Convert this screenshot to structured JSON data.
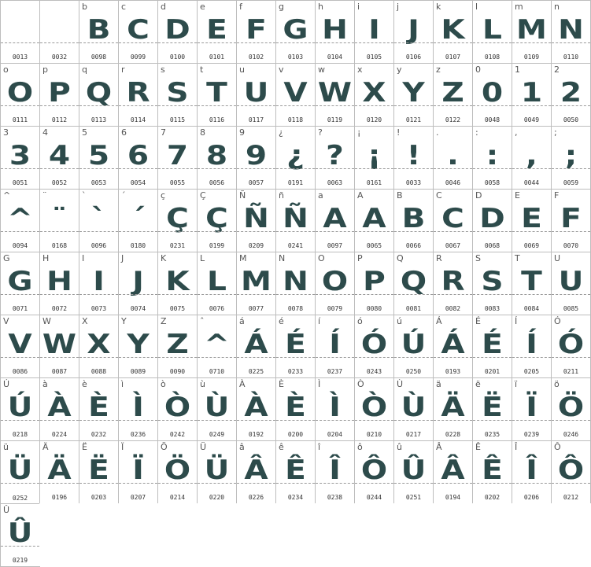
{
  "colors": {
    "glyph": "#2d4b4b",
    "grid": "#bdbdbd",
    "baseline": "#9a9a9a"
  },
  "glyphs": [
    {
      "label": "",
      "glyph": "",
      "code": "0013"
    },
    {
      "label": "",
      "glyph": "",
      "code": "0032"
    },
    {
      "label": "b",
      "glyph": "B",
      "code": "0098"
    },
    {
      "label": "c",
      "glyph": "C",
      "code": "0099"
    },
    {
      "label": "d",
      "glyph": "D",
      "code": "0100"
    },
    {
      "label": "e",
      "glyph": "E",
      "code": "0101"
    },
    {
      "label": "f",
      "glyph": "F",
      "code": "0102"
    },
    {
      "label": "g",
      "glyph": "G",
      "code": "0103"
    },
    {
      "label": "h",
      "glyph": "H",
      "code": "0104"
    },
    {
      "label": "i",
      "glyph": "I",
      "code": "0105"
    },
    {
      "label": "j",
      "glyph": "J",
      "code": "0106"
    },
    {
      "label": "k",
      "glyph": "K",
      "code": "0107"
    },
    {
      "label": "l",
      "glyph": "L",
      "code": "0108"
    },
    {
      "label": "m",
      "glyph": "M",
      "code": "0109"
    },
    {
      "label": "n",
      "glyph": "N",
      "code": "0110"
    },
    {
      "label": "o",
      "glyph": "O",
      "code": "0111"
    },
    {
      "label": "p",
      "glyph": "P",
      "code": "0112"
    },
    {
      "label": "q",
      "glyph": "Q",
      "code": "0113"
    },
    {
      "label": "r",
      "glyph": "R",
      "code": "0114"
    },
    {
      "label": "s",
      "glyph": "S",
      "code": "0115"
    },
    {
      "label": "t",
      "glyph": "T",
      "code": "0116"
    },
    {
      "label": "u",
      "glyph": "U",
      "code": "0117"
    },
    {
      "label": "v",
      "glyph": "V",
      "code": "0118"
    },
    {
      "label": "w",
      "glyph": "W",
      "code": "0119"
    },
    {
      "label": "x",
      "glyph": "X",
      "code": "0120"
    },
    {
      "label": "y",
      "glyph": "Y",
      "code": "0121"
    },
    {
      "label": "z",
      "glyph": "Z",
      "code": "0122"
    },
    {
      "label": "0",
      "glyph": "0",
      "code": "0048"
    },
    {
      "label": "1",
      "glyph": "1",
      "code": "0049"
    },
    {
      "label": "2",
      "glyph": "2",
      "code": "0050"
    },
    {
      "label": "3",
      "glyph": "3",
      "code": "0051"
    },
    {
      "label": "4",
      "glyph": "4",
      "code": "0052"
    },
    {
      "label": "5",
      "glyph": "5",
      "code": "0053"
    },
    {
      "label": "6",
      "glyph": "6",
      "code": "0054"
    },
    {
      "label": "7",
      "glyph": "7",
      "code": "0055"
    },
    {
      "label": "8",
      "glyph": "8",
      "code": "0056"
    },
    {
      "label": "9",
      "glyph": "9",
      "code": "0057"
    },
    {
      "label": "¿",
      "glyph": "¿",
      "code": "0191"
    },
    {
      "label": "?",
      "glyph": "?",
      "code": "0063"
    },
    {
      "label": "¡",
      "glyph": "¡",
      "code": "0161"
    },
    {
      "label": "!",
      "glyph": "!",
      "code": "0033"
    },
    {
      "label": ".",
      "glyph": ".",
      "code": "0046"
    },
    {
      "label": ":",
      "glyph": ":",
      "code": "0058"
    },
    {
      "label": ",",
      "glyph": ",",
      "code": "0044"
    },
    {
      "label": ";",
      "glyph": ";",
      "code": "0059"
    },
    {
      "label": "^",
      "glyph": "^",
      "code": "0094"
    },
    {
      "label": "¨",
      "glyph": "¨",
      "code": "0168"
    },
    {
      "label": "`",
      "glyph": "`",
      "code": "0096"
    },
    {
      "label": "´",
      "glyph": "´",
      "code": "0180"
    },
    {
      "label": "ç",
      "glyph": "Ç",
      "code": "0231"
    },
    {
      "label": "Ç",
      "glyph": "Ç",
      "code": "0199"
    },
    {
      "label": "Ñ",
      "glyph": "Ñ",
      "code": "0209"
    },
    {
      "label": "ñ",
      "glyph": "Ñ",
      "code": "0241"
    },
    {
      "label": "a",
      "glyph": "A",
      "code": "0097"
    },
    {
      "label": "A",
      "glyph": "A",
      "code": "0065"
    },
    {
      "label": "B",
      "glyph": "B",
      "code": "0066"
    },
    {
      "label": "C",
      "glyph": "C",
      "code": "0067"
    },
    {
      "label": "D",
      "glyph": "D",
      "code": "0068"
    },
    {
      "label": "E",
      "glyph": "E",
      "code": "0069"
    },
    {
      "label": "F",
      "glyph": "F",
      "code": "0070"
    },
    {
      "label": "G",
      "glyph": "G",
      "code": "0071"
    },
    {
      "label": "H",
      "glyph": "H",
      "code": "0072"
    },
    {
      "label": "I",
      "glyph": "I",
      "code": "0073"
    },
    {
      "label": "J",
      "glyph": "J",
      "code": "0074"
    },
    {
      "label": "K",
      "glyph": "K",
      "code": "0075"
    },
    {
      "label": "L",
      "glyph": "L",
      "code": "0076"
    },
    {
      "label": "M",
      "glyph": "M",
      "code": "0077"
    },
    {
      "label": "N",
      "glyph": "N",
      "code": "0078"
    },
    {
      "label": "O",
      "glyph": "O",
      "code": "0079"
    },
    {
      "label": "P",
      "glyph": "P",
      "code": "0080"
    },
    {
      "label": "Q",
      "glyph": "Q",
      "code": "0081"
    },
    {
      "label": "R",
      "glyph": "R",
      "code": "0082"
    },
    {
      "label": "S",
      "glyph": "S",
      "code": "0083"
    },
    {
      "label": "T",
      "glyph": "T",
      "code": "0084"
    },
    {
      "label": "U",
      "glyph": "U",
      "code": "0085"
    },
    {
      "label": "V",
      "glyph": "V",
      "code": "0086"
    },
    {
      "label": "W",
      "glyph": "W",
      "code": "0087"
    },
    {
      "label": "X",
      "glyph": "X",
      "code": "0088"
    },
    {
      "label": "Y",
      "glyph": "Y",
      "code": "0089"
    },
    {
      "label": "Z",
      "glyph": "Z",
      "code": "0090"
    },
    {
      "label": "ˆ",
      "glyph": "^",
      "code": "0710"
    },
    {
      "label": "á",
      "glyph": "Á",
      "code": "0225"
    },
    {
      "label": "é",
      "glyph": "É",
      "code": "0233"
    },
    {
      "label": "í",
      "glyph": "Í",
      "code": "0237"
    },
    {
      "label": "ó",
      "glyph": "Ó",
      "code": "0243"
    },
    {
      "label": "ú",
      "glyph": "Ú",
      "code": "0250"
    },
    {
      "label": "Á",
      "glyph": "Á",
      "code": "0193"
    },
    {
      "label": "É",
      "glyph": "É",
      "code": "0201"
    },
    {
      "label": "Í",
      "glyph": "Í",
      "code": "0205"
    },
    {
      "label": "Ó",
      "glyph": "Ó",
      "code": "0211"
    },
    {
      "label": "Ú",
      "glyph": "Ú",
      "code": "0218"
    },
    {
      "label": "à",
      "glyph": "À",
      "code": "0224"
    },
    {
      "label": "è",
      "glyph": "È",
      "code": "0232"
    },
    {
      "label": "ì",
      "glyph": "Ì",
      "code": "0236"
    },
    {
      "label": "ò",
      "glyph": "Ò",
      "code": "0242"
    },
    {
      "label": "ù",
      "glyph": "Ù",
      "code": "0249"
    },
    {
      "label": "À",
      "glyph": "À",
      "code": "0192"
    },
    {
      "label": "È",
      "glyph": "È",
      "code": "0200"
    },
    {
      "label": "Ì",
      "glyph": "Ì",
      "code": "0204"
    },
    {
      "label": "Ò",
      "glyph": "Ò",
      "code": "0210"
    },
    {
      "label": "Ù",
      "glyph": "Ù",
      "code": "0217"
    },
    {
      "label": "ä",
      "glyph": "Ä",
      "code": "0228"
    },
    {
      "label": "ë",
      "glyph": "Ë",
      "code": "0235"
    },
    {
      "label": "ï",
      "glyph": "Ï",
      "code": "0239"
    },
    {
      "label": "ö",
      "glyph": "Ö",
      "code": "0246"
    },
    {
      "label": "ü",
      "glyph": "Ü",
      "code": "0252"
    },
    {
      "label": "Ä",
      "glyph": "Ä",
      "code": "0196"
    },
    {
      "label": "Ë",
      "glyph": "Ë",
      "code": "0203"
    },
    {
      "label": "Ï",
      "glyph": "Ï",
      "code": "0207"
    },
    {
      "label": "Ö",
      "glyph": "Ö",
      "code": "0214"
    },
    {
      "label": "Ü",
      "glyph": "Ü",
      "code": "0220"
    },
    {
      "label": "â",
      "glyph": "Â",
      "code": "0226"
    },
    {
      "label": "ê",
      "glyph": "Ê",
      "code": "0234"
    },
    {
      "label": "î",
      "glyph": "Î",
      "code": "0238"
    },
    {
      "label": "ô",
      "glyph": "Ô",
      "code": "0244"
    },
    {
      "label": "û",
      "glyph": "Û",
      "code": "0251"
    },
    {
      "label": "Â",
      "glyph": "Â",
      "code": "0194"
    },
    {
      "label": "Ê",
      "glyph": "Ê",
      "code": "0202"
    },
    {
      "label": "Î",
      "glyph": "Î",
      "code": "0206"
    },
    {
      "label": "Ô",
      "glyph": "Ô",
      "code": "0212"
    },
    {
      "label": "Û",
      "glyph": "Û",
      "code": "0219"
    }
  ]
}
